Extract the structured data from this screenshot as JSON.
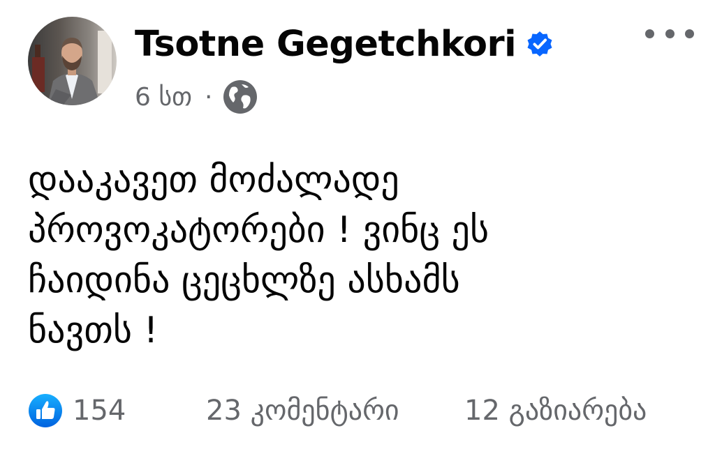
{
  "post": {
    "author": {
      "name": "Tsotne Gegetchkori",
      "verified": true,
      "verified_icon": "verified-badge-icon",
      "avatar": "profile-photo"
    },
    "meta": {
      "time": "6 სთ",
      "separator": "·",
      "audience_icon": "globe-icon"
    },
    "menu_icon": "more-options-icon",
    "text_lines": [
      "დააკავეთ მოძალადე",
      "პროვოკატორები ! ვინც ეს",
      "ჩაიდინა ცეცხლზე ასხამს",
      "ნავთს !"
    ],
    "stats": {
      "reaction_icon": "like-icon",
      "likes": "154",
      "comments": "23 კომენტარი",
      "shares": "12 გაზიარება"
    },
    "colors": {
      "text": "#050505",
      "secondary": "#65676b",
      "brand_blue": "#0866ff"
    }
  }
}
